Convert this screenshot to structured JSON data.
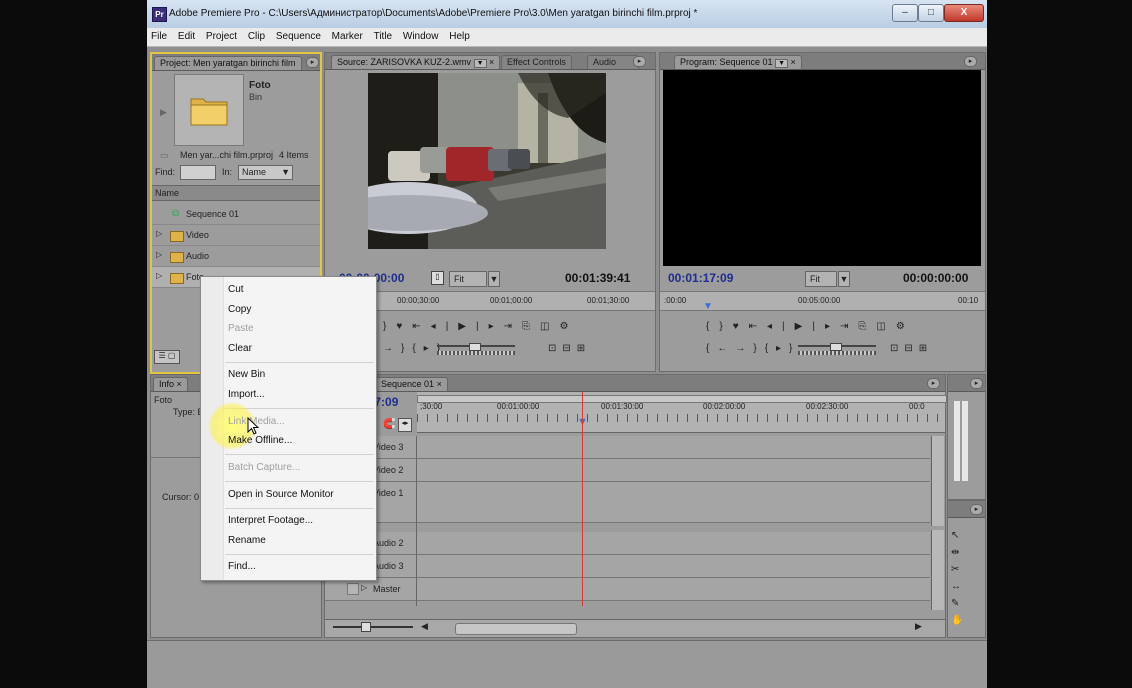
{
  "window": {
    "title": "Adobe Premiere Pro - C:\\Users\\Администратор\\Documents\\Adobe\\Premiere Pro\\3.0\\Men yaratgan birinchi film.prproj *",
    "app_icon": "Pr",
    "minimize": "–",
    "maximize": "□",
    "close": "X"
  },
  "menu": [
    "File",
    "Edit",
    "Project",
    "Clip",
    "Sequence",
    "Marker",
    "Title",
    "Window",
    "Help"
  ],
  "project_panel": {
    "tab": "Project: Men yaratgan birinchi film",
    "bin_name": "Foto",
    "bin_type": "Bin",
    "file_info": "Men yar...chi film.prproj",
    "item_count": "4 Items",
    "find_label": "Find:",
    "in_label": "In:",
    "in_value": "Name",
    "column_header": "Name",
    "items": [
      "Sequence 01",
      "Video",
      "Audio",
      "Foto"
    ]
  },
  "source_panel": {
    "tabs": [
      "Source: ZARISOVKA KUZ-2.wmv",
      "Effect Controls",
      "Audio"
    ],
    "timecode_in": "00:00:00:00",
    "fit": "Fit",
    "timecode_out": "00:01:39:41",
    "ruler": [
      "00:00;30:00",
      "00:01;00:00",
      "00:01;30:00"
    ]
  },
  "program_panel": {
    "tab": "Program: Sequence 01",
    "timecode_in": "00:01:17:09",
    "fit": "Fit",
    "timecode_out": "00:00:00:00",
    "ruler": [
      ":00:00",
      "00:05:00:00",
      "00:10"
    ]
  },
  "info_panel": {
    "tab": "Info",
    "name": "Foto",
    "type_label": "Type: B",
    "cursor_label": "Cursor: 0"
  },
  "timeline": {
    "tab": "Sequence 01",
    "timecode": "00:01:17:09",
    "ruler": [
      ";30:00",
      "00:01:00:00",
      "00:01:30:00",
      "00:02:00:00",
      "00:02:30:00",
      "00:0"
    ],
    "tracks": [
      "Video 3",
      "Video 2",
      "Video 1",
      "Audio 2",
      "Audio 3",
      "Master"
    ]
  },
  "context_menu": {
    "items": [
      {
        "label": "Cut",
        "enabled": true
      },
      {
        "label": "Copy",
        "enabled": true
      },
      {
        "label": "Paste",
        "enabled": false
      },
      {
        "label": "Clear",
        "enabled": true
      },
      {
        "label": "New Bin",
        "enabled": true
      },
      {
        "label": "Import...",
        "enabled": true
      },
      {
        "label": "Link Media...",
        "enabled": false
      },
      {
        "label": "Make Offline...",
        "enabled": true
      },
      {
        "label": "Batch Capture...",
        "enabled": false
      },
      {
        "label": "Open in Source Monitor",
        "enabled": true
      },
      {
        "label": "Interpret Footage...",
        "enabled": true
      },
      {
        "label": "Rename",
        "enabled": true
      },
      {
        "label": "Find...",
        "enabled": true
      }
    ]
  },
  "colors": {
    "panel_bg": "#9c9c9c",
    "highlight_yellow": "#ffec3c",
    "timecode_blue": "#1e2d8f",
    "playhead_red": "#d83a2a"
  }
}
